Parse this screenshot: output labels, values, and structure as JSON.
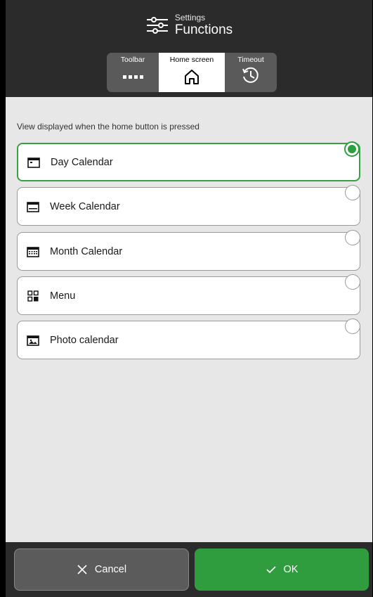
{
  "header": {
    "subtitle": "Settings",
    "title": "Functions",
    "icon": "sliders-icon"
  },
  "tabs": [
    {
      "label": "Toolbar",
      "icon": "toolbar-dots-icon",
      "active": false
    },
    {
      "label": "Home screen",
      "icon": "home-icon",
      "active": true
    },
    {
      "label": "Timeout",
      "icon": "history-clock-icon",
      "active": false
    }
  ],
  "content": {
    "description": "View displayed when the home button is pressed",
    "options": [
      {
        "label": "Day Calendar",
        "icon": "day-calendar-icon",
        "selected": true
      },
      {
        "label": "Week Calendar",
        "icon": "week-calendar-icon",
        "selected": false
      },
      {
        "label": "Month Calendar",
        "icon": "month-calendar-icon",
        "selected": false
      },
      {
        "label": "Menu",
        "icon": "menu-grid-icon",
        "selected": false
      },
      {
        "label": "Photo calendar",
        "icon": "photo-calendar-icon",
        "selected": false
      }
    ]
  },
  "footer": {
    "cancel_label": "Cancel",
    "ok_label": "OK"
  },
  "colors": {
    "accent": "#2f9c3d",
    "header_bg": "#2b2b2b",
    "content_bg": "#e7e7e7"
  }
}
